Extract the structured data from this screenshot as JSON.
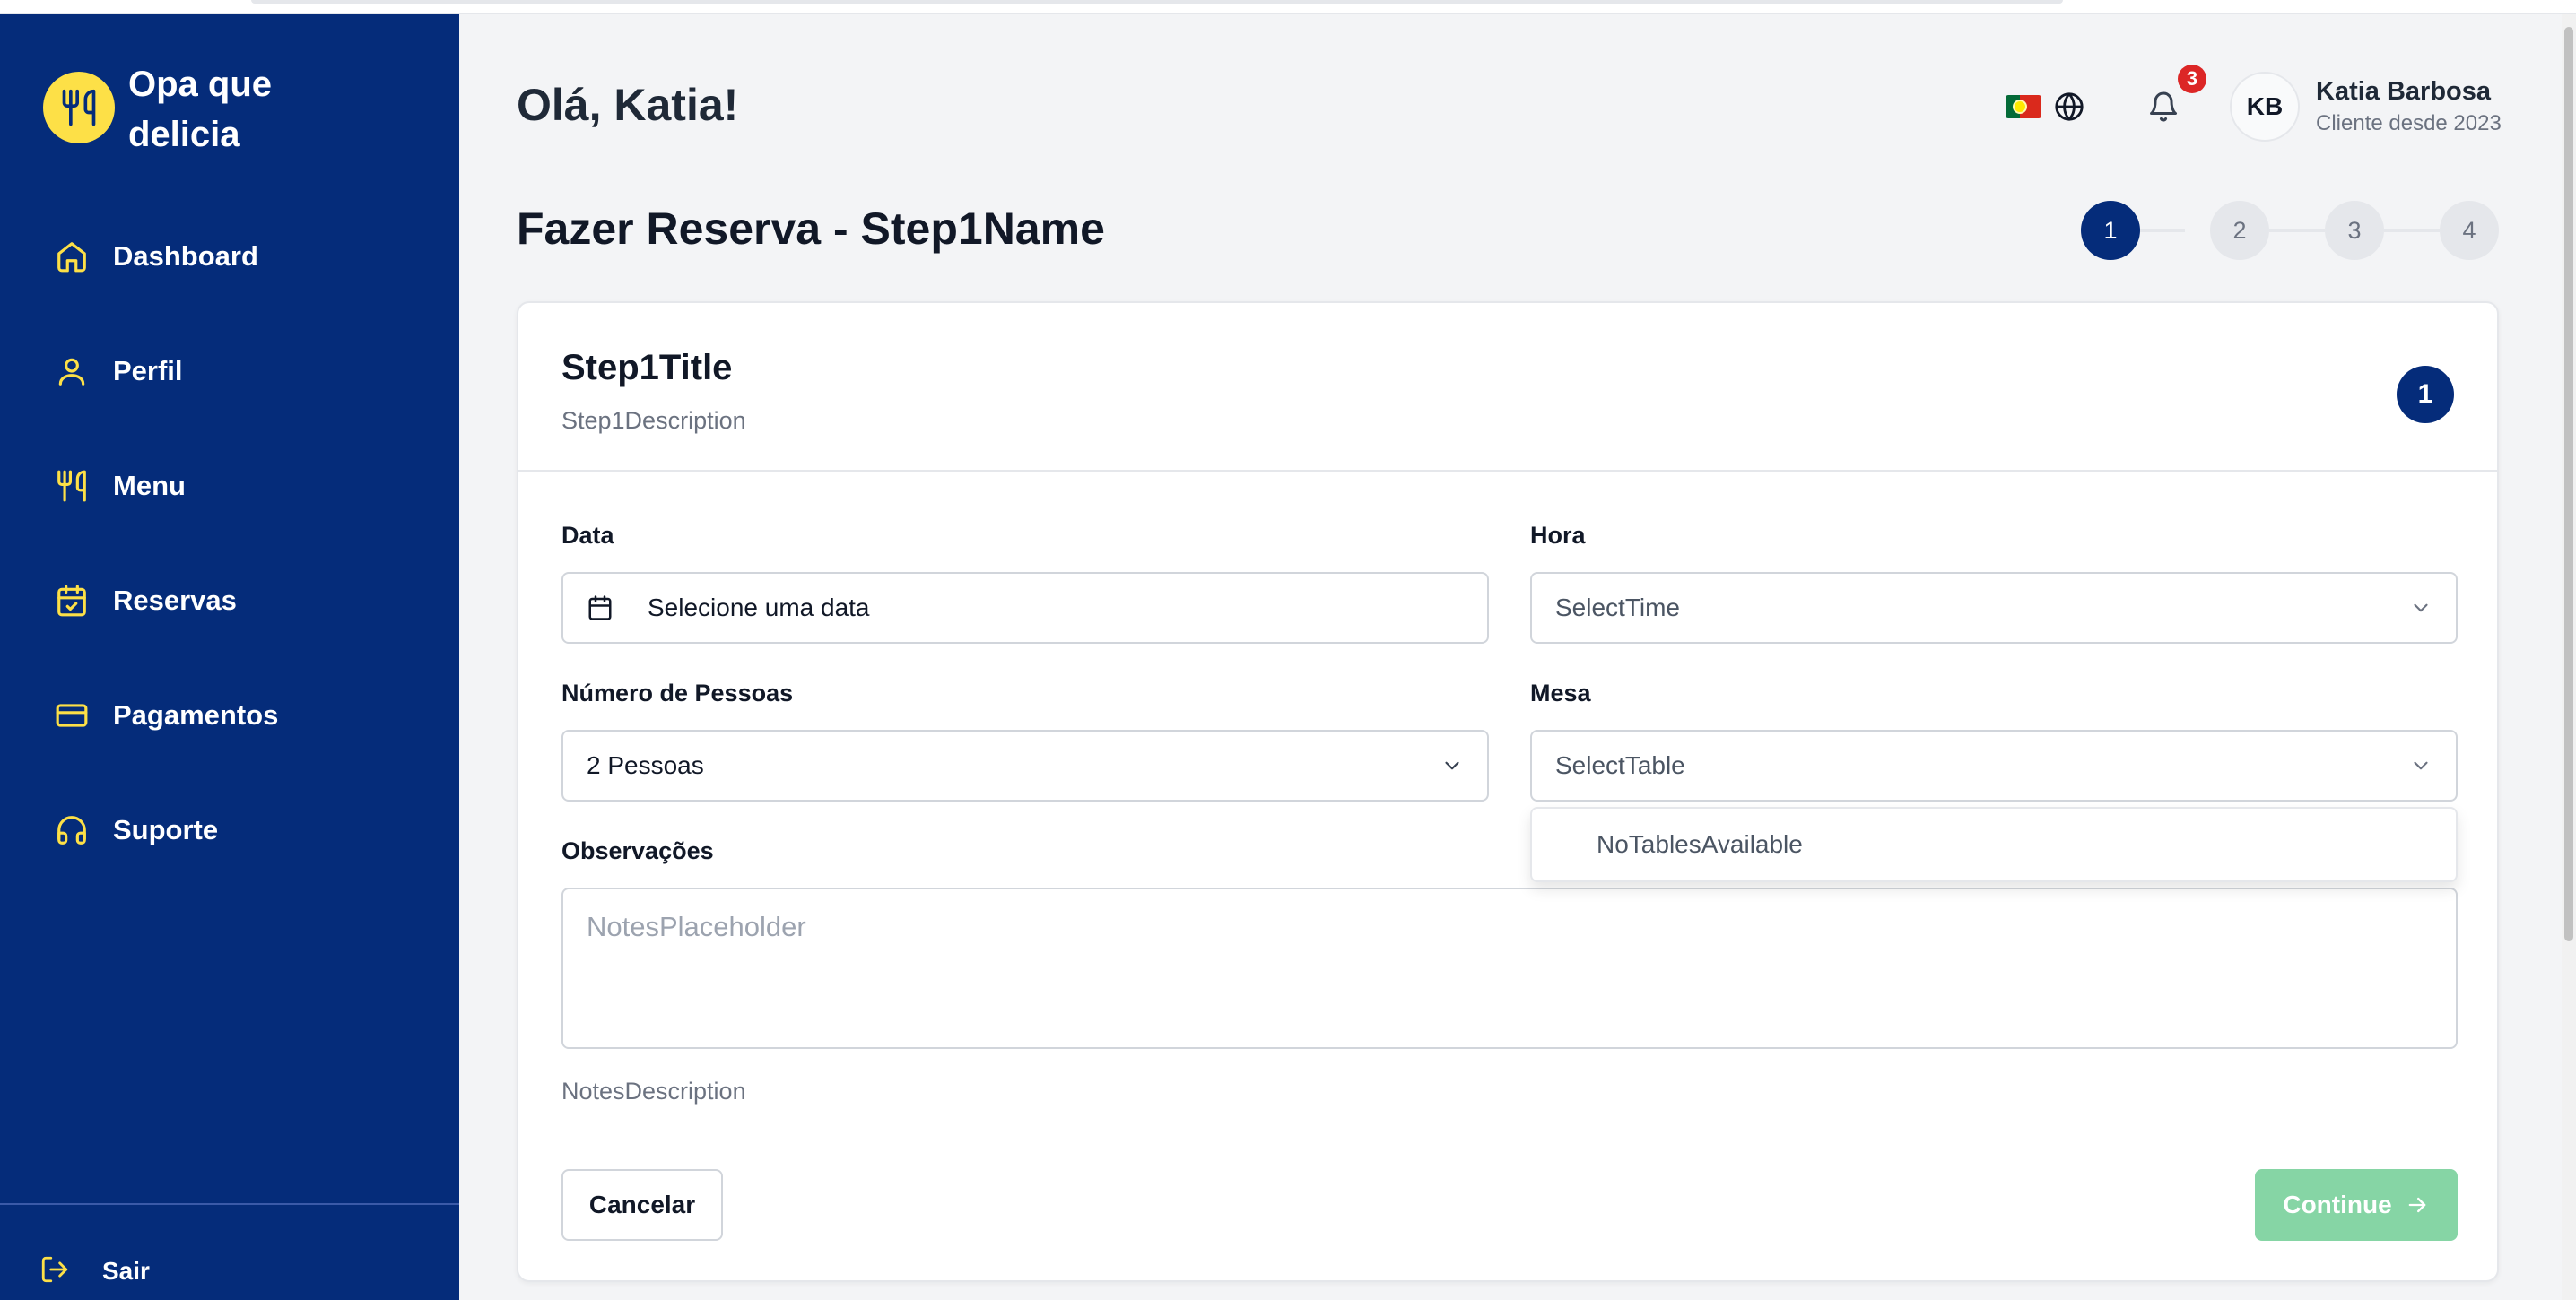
{
  "brand": {
    "name": "Opa que delicia",
    "logo_icon": "utensils-icon",
    "logo_color": "#fde047"
  },
  "colors": {
    "sidebar_bg": "#052c7a",
    "accent": "#052c7a",
    "continue_disabled": "#86d5a5",
    "badge": "#dc2626"
  },
  "sidebar": {
    "items": [
      {
        "label": "Dashboard",
        "icon": "home-icon"
      },
      {
        "label": "Perfil",
        "icon": "user-icon"
      },
      {
        "label": "Menu",
        "icon": "utensils-icon"
      },
      {
        "label": "Reservas",
        "icon": "calendar-check-icon"
      },
      {
        "label": "Pagamentos",
        "icon": "credit-card-icon"
      },
      {
        "label": "Suporte",
        "icon": "headphones-icon"
      }
    ],
    "logout_label": "Sair"
  },
  "header": {
    "greeting": "Olá, Katia!",
    "notifications_count": "3",
    "user": {
      "initials": "KB",
      "name": "Katia Barbosa",
      "since": "Cliente desde 2023"
    }
  },
  "page": {
    "title": "Fazer Reserva - Step1Name"
  },
  "stepper": {
    "steps": [
      "1",
      "2",
      "3",
      "4"
    ],
    "current": "1"
  },
  "form": {
    "title": "Step1Title",
    "description": "Step1Description",
    "step_badge": "1",
    "date": {
      "label": "Data",
      "value": "Selecione uma data"
    },
    "time": {
      "label": "Hora",
      "placeholder": "SelectTime"
    },
    "people": {
      "label": "Número de Pessoas",
      "value": "2 Pessoas"
    },
    "table": {
      "label": "Mesa",
      "placeholder": "SelectTable",
      "dropdown_option": "NoTablesAvailable"
    },
    "notes": {
      "label": "Observações",
      "placeholder": "NotesPlaceholder",
      "description": "NotesDescription"
    },
    "cancel_label": "Cancelar",
    "continue_label": "Continue"
  }
}
